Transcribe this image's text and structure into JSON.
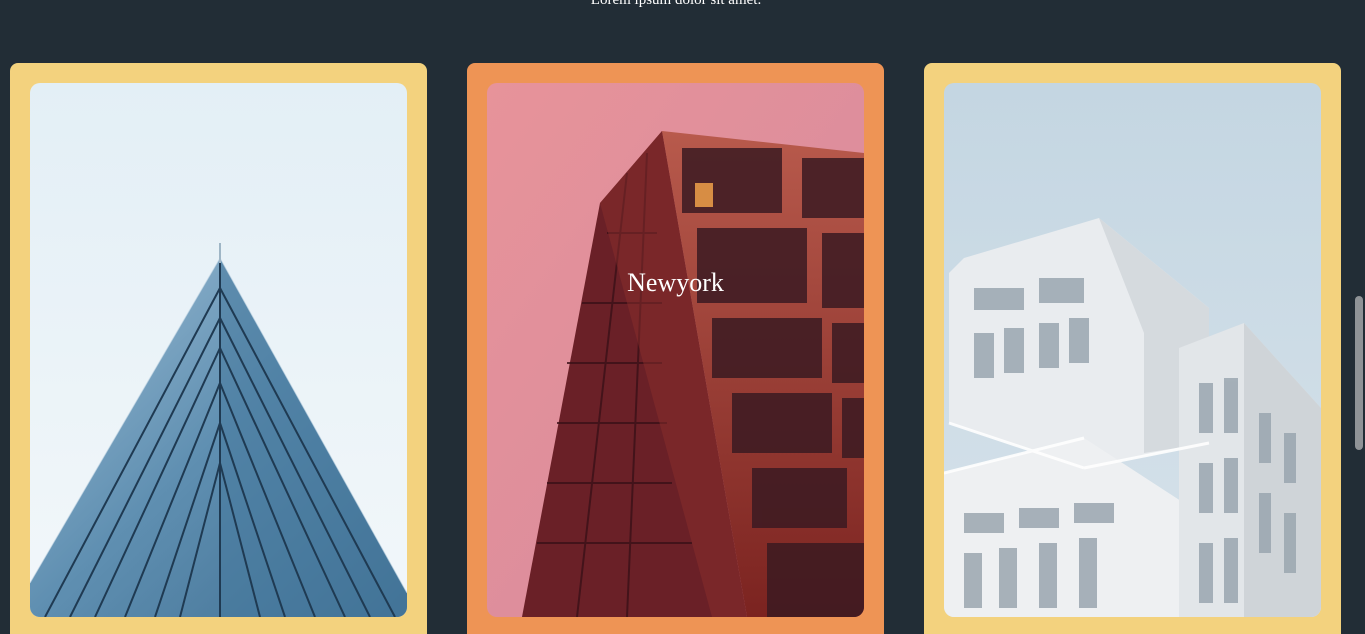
{
  "header": {
    "subtitle": "Lorem ipsum dolor sit amet."
  },
  "cards": [
    {
      "image_name": "glass-pyramid-building-image",
      "title": ""
    },
    {
      "image_name": "red-tower-building-image",
      "title": "Newyork"
    },
    {
      "image_name": "white-modular-building-image",
      "title": ""
    }
  ],
  "colors": {
    "background": "#222d36",
    "card_yellow": "#f3d27e",
    "card_orange": "#ee9455"
  }
}
